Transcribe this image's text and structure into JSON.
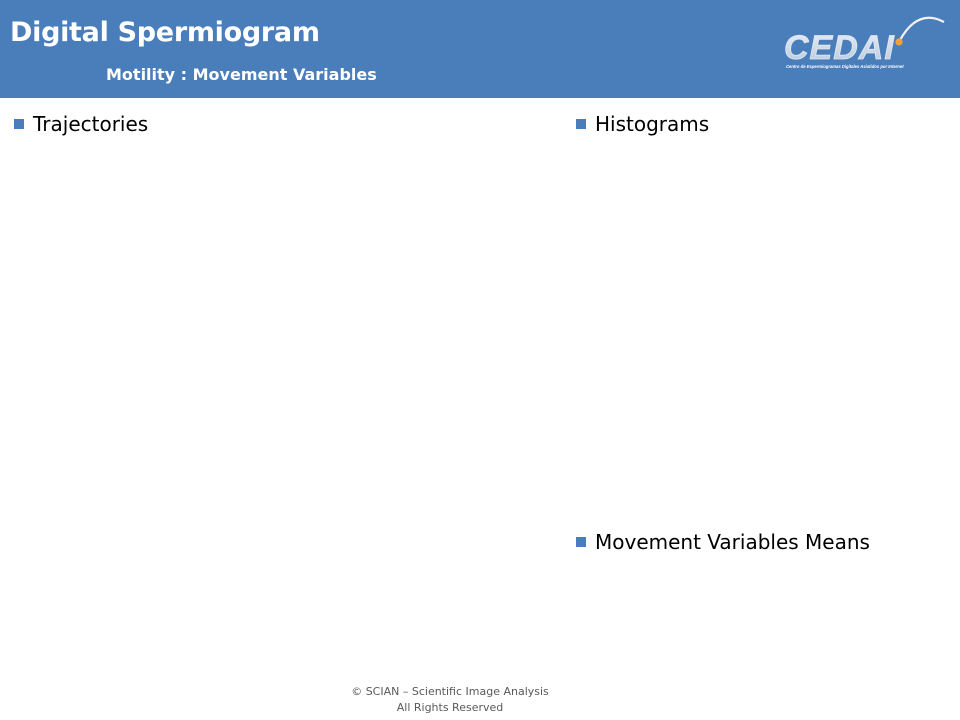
{
  "header": {
    "title": "Digital Spermiogram",
    "subtitle": "Motility : Movement Variables",
    "logo": {
      "text": "CEDAI",
      "tagline": "Centro de Espermiogramas Digitales Asistidos por Internet",
      "icon": "cedai-logo"
    }
  },
  "sections": {
    "trajectories": "Trajectories",
    "histograms": "Histograms",
    "means": "Movement Variables Means"
  },
  "footer": {
    "line1": "© SCIAN – Scientific Image Analysis",
    "line2": "All Rights Reserved"
  },
  "colors": {
    "header_bg": "#4a7ebb",
    "bullet": "#4a7ebb"
  }
}
